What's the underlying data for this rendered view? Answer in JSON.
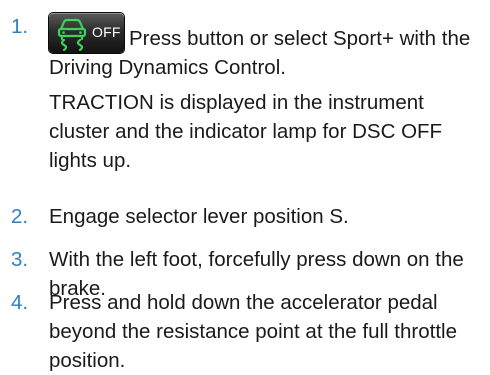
{
  "steps": [
    {
      "number": "1.",
      "button_label": "OFF",
      "icon": "dsc-car-skid-icon",
      "text": "Press button or select Sport+ with the Driving Dynamics Control.",
      "note": "TRACTION is displayed in the instrument cluster and the indicator lamp for DSC OFF lights up."
    },
    {
      "number": "2.",
      "text": "Engage selector lever position S."
    },
    {
      "number": "3.",
      "text": "With the left foot, forcefully press down on the brake."
    },
    {
      "number": "4.",
      "text": "Press and hold down the accelerator pedal beyond the resistance point at the full throttle position."
    }
  ],
  "colors": {
    "step_number": "#2f7fc1",
    "body_text": "#1a1a1a",
    "button_dark": "#1c1c1c",
    "icon_green": "#3fd15a"
  }
}
